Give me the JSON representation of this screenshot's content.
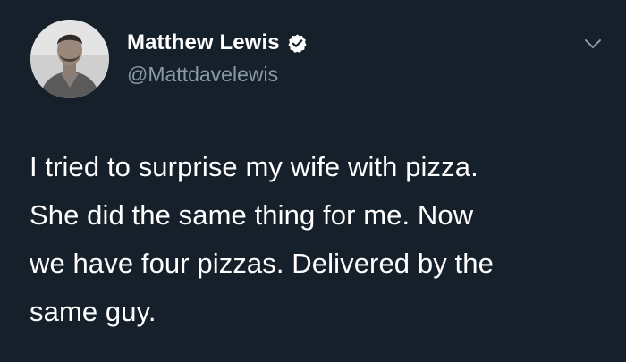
{
  "user": {
    "display_name": "Matthew Lewis",
    "handle": "@Mattdavelewis",
    "verified": true,
    "avatar_icon": "profile-photo"
  },
  "tweet": {
    "text": "I tried to surprise my wife with pizza.\nShe did the same thing for me. Now\nwe have four pizzas. Delivered by the\nsame guy."
  },
  "icons": {
    "verified": "verified-badge-icon",
    "menu": "chevron-down-icon"
  },
  "colors": {
    "background": "#15202b",
    "text_primary": "#ffffff",
    "text_secondary": "#8899a6",
    "verified_fill": "#ffffff"
  }
}
